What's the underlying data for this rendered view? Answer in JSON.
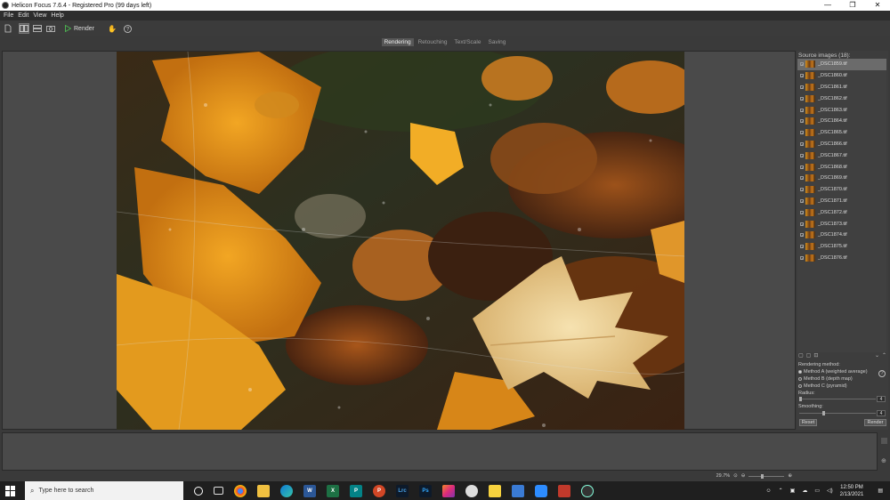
{
  "window": {
    "title": "Helicon Focus 7.6.4 - Registered Pro  (99 days left)"
  },
  "menu": [
    "File",
    "Edit",
    "View",
    "Help"
  ],
  "toolbar": {
    "render_label": "Render"
  },
  "tabs": [
    {
      "label": "Rendering",
      "selected": true
    },
    {
      "label": "Retouching",
      "selected": false
    },
    {
      "label": "Text/Scale",
      "selected": false
    },
    {
      "label": "Saving",
      "selected": false
    }
  ],
  "panel": {
    "header": "Source images (18):",
    "files": [
      "_DSC1859.tif",
      "_DSC1860.tif",
      "_DSC1861.tif",
      "_DSC1862.tif",
      "_DSC1863.tif",
      "_DSC1864.tif",
      "_DSC1865.tif",
      "_DSC1866.tif",
      "_DSC1867.tif",
      "_DSC1868.tif",
      "_DSC1869.tif",
      "_DSC1870.tif",
      "_DSC1871.tif",
      "_DSC1872.tif",
      "_DSC1873.tif",
      "_DSC1874.tif",
      "_DSC1875.tif",
      "_DSC1876.tif"
    ],
    "rendering_method_label": "Rendering method:",
    "methods": [
      {
        "label": "Method A (weighted average)",
        "selected": true
      },
      {
        "label": "Method B (depth map)",
        "selected": false
      },
      {
        "label": "Method C (pyramid)",
        "selected": false
      }
    ],
    "radius_label": "Radius:",
    "radius_value": "4",
    "smoothing_label": "Smoothing:",
    "smoothing_value": "4",
    "reset_label": "Reset",
    "render_label": "Render"
  },
  "status": {
    "zoom": "29.7%"
  },
  "taskbar": {
    "search_placeholder": "Type here to search",
    "time": "12:50 PM",
    "date": "2/13/2021"
  },
  "colors": {
    "accent": "#4caf50",
    "background": "#3a3a3a",
    "leaf": "#e39a1e"
  }
}
